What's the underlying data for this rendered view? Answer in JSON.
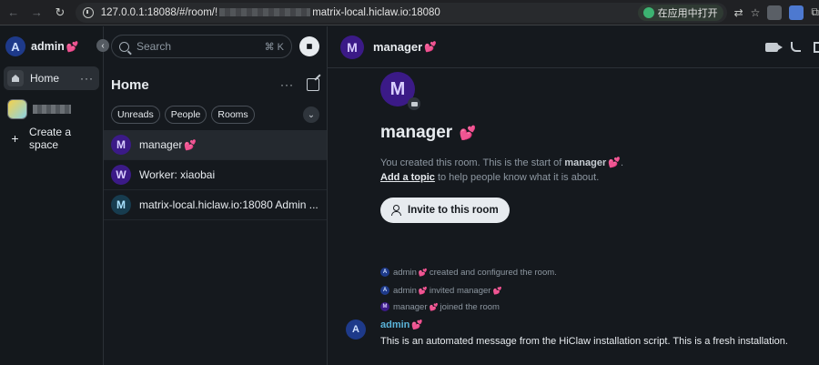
{
  "browser": {
    "url_prefix": "127.0.0.1:18088/#/room/!",
    "url_suffix": "matrix-local.hiclaw.io:18080",
    "open_in_app": "在应用中打开"
  },
  "colors": {
    "heart": "#e8506f",
    "sender_name": "#5ab3d9",
    "avatar_admin": "#1e3a8a",
    "avatar_manager": "#3b1a87"
  },
  "user": {
    "initial": "A",
    "name": "admin",
    "heart": "💕"
  },
  "spaces": {
    "home_label": "Home",
    "more": "···",
    "create_label": "Create a space",
    "plus": "+"
  },
  "search": {
    "placeholder": "Search",
    "shortcut": "⌘ K"
  },
  "room_list": {
    "title": "Home",
    "more": "···",
    "filters": [
      "Unreads",
      "People",
      "Rooms"
    ],
    "toggle": "⌄",
    "rooms": [
      {
        "initial": "M",
        "name": "manager",
        "heart": "💕"
      },
      {
        "initial": "W",
        "name": "Worker: xiaobai",
        "heart": ""
      },
      {
        "initial": "M",
        "name": "matrix-local.hiclaw.io:18080 Admin ...",
        "heart": ""
      }
    ]
  },
  "room": {
    "initial": "M",
    "name": "manager",
    "heart": "💕",
    "intro_prefix": "You created this room. This is the start of ",
    "intro_name": "manager",
    "intro_suffix": ".",
    "topic_link": "Add a topic",
    "topic_text": " to help people know what it is about.",
    "invite_label": "Invite to this room"
  },
  "events": [
    {
      "initial": "A",
      "actor": "admin",
      "text": "created and configured the room."
    },
    {
      "initial": "A",
      "actor": "admin",
      "text": "invited manager"
    },
    {
      "initial": "M",
      "actor": "manager",
      "text": "joined the room"
    }
  ],
  "message": {
    "initial": "A",
    "sender": "admin",
    "text": "This is an automated message from the HiClaw installation script. This is a fresh installation."
  }
}
